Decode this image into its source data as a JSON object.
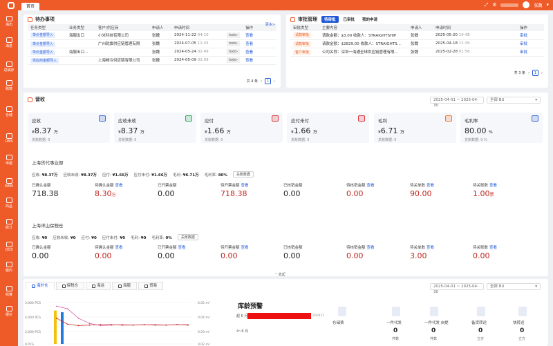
{
  "topbar": {
    "tab": "首页",
    "user": "张魏"
  },
  "sidebar": [
    {
      "label": "海出",
      "icon": "ship-icon"
    },
    {
      "label": "海进",
      "icon": "anchor-icon"
    },
    {
      "label": "进销存",
      "icon": "inventory-icon"
    },
    {
      "label": "跨境",
      "icon": "globe-icon"
    },
    {
      "label": "仓储",
      "icon": "warehouse-icon"
    },
    {
      "label": "OMS",
      "icon": "oms-icon"
    },
    {
      "label": "申报",
      "icon": "declare-icon"
    },
    {
      "label": "WMS",
      "icon": "wms-icon"
    },
    {
      "label": "商品",
      "icon": "goods-icon"
    },
    {
      "label": "统计",
      "icon": "stats-icon"
    },
    {
      "label": "OOS",
      "icon": "oos-icon"
    },
    {
      "label": "履约",
      "icon": "fulfill-icon"
    },
    {
      "label": "结算",
      "icon": "settle-icon"
    },
    {
      "label": "报价",
      "icon": "quote-icon"
    }
  ],
  "todo": {
    "title": "待办事项",
    "more": "更多>",
    "columns": [
      "任务类型",
      "业务类型",
      "客户/供应商",
      "申请人",
      "申请时间",
      "操作"
    ],
    "rows": [
      {
        "type": "单价金额导入",
        "biz": "海服出口",
        "cust": "小米科技有限公司",
        "applicant": "张魏",
        "date": "2024-11-22",
        "time": "04:10",
        "op": "查看",
        "tag": "todo-"
      },
      {
        "type": "单价金额导入",
        "biz": "",
        "cust": "广州乾旗供应链管理有限",
        "applicant": "张魏",
        "date": "2024-07-05",
        "time": "11:43",
        "op": "查看",
        "tag": "todo-"
      },
      {
        "type": "单价金额导入",
        "biz": "海服出口...",
        "cust": "",
        "applicant": "张魏",
        "date": "2024-05-24",
        "time": "02:49",
        "op": "查看",
        "tag": "todo-"
      },
      {
        "type": "供应商金额导入",
        "biz": "",
        "cust": "上海畅冷供应链有限公司",
        "applicant": "张魏",
        "date": "2024-05-09",
        "time": "02:09",
        "op": "查看",
        "tag": "todo-"
      }
    ],
    "total": "共 4 条",
    "page": "1"
  },
  "approval": {
    "title": "审批管理",
    "tabs": [
      "待审批",
      "已审批",
      "我的申请"
    ],
    "columns": [
      "审批类型",
      "主要内容",
      "申请人",
      "申请时间",
      "操作"
    ],
    "rows": [
      {
        "type": "请款审批",
        "content": "请款金额：$3.00 收款人：STRAIGHTSHIP",
        "applicant": "张魏",
        "date": "2025-05-20",
        "time": "10:48",
        "op": "审批"
      },
      {
        "type": "请款审批",
        "content": "请款金额：$2829.00 收款人：STRAIGHTS...",
        "applicant": "张魏",
        "date": "2025-04-18",
        "time": "12:39",
        "op": "审批"
      },
      {
        "type": "客户审批",
        "content": "公司名称：深圳一海通全球供应链管理有限...",
        "applicant": "张魏",
        "date": "2025-02-28",
        "time": "01:56",
        "op": "审批"
      }
    ],
    "total": "共 3 条",
    "page": "1"
  },
  "revenue": {
    "title": "营收",
    "date_range": "2025-04-01 ~ 2025-04-30",
    "bu": "全部 BU",
    "cards": [
      {
        "label": "应收",
        "cur": "¥",
        "value": "8.37",
        "unit": "万",
        "sub": "关账数据: 0",
        "color": "#3b6fd9"
      },
      {
        "label": "应收未收",
        "cur": "¥",
        "value": "8.37",
        "unit": "万",
        "sub": "关账数据: 0",
        "color": "#2fae5e"
      },
      {
        "label": "应付",
        "cur": "¥",
        "value": "1.66",
        "unit": "万",
        "sub": "关账数据: 0",
        "color": "#e0393e"
      },
      {
        "label": "应付未付",
        "cur": "¥",
        "value": "1.66",
        "unit": "万",
        "sub": "关账数据: 0",
        "color": "#e0393e"
      },
      {
        "label": "毛利",
        "cur": "¥",
        "value": "6.71",
        "unit": "万",
        "sub": "关账数据: 0",
        "color": "#ef7a29"
      },
      {
        "label": "毛利率",
        "cur": "",
        "value": "80.00",
        "unit": "%",
        "sub": "关账数据: 0 %",
        "color": "#3b6fd9"
      }
    ]
  },
  "dept1": {
    "name": "上海货代事业部",
    "summary": [
      {
        "k": "应收:",
        "v": "¥8.37万"
      },
      {
        "k": "应收未收:",
        "v": "¥8.37万"
      },
      {
        "k": "应付:",
        "v": "¥1.66万"
      },
      {
        "k": "应付未付:",
        "v": "¥1.66万"
      },
      {
        "k": "毛利:",
        "v": "¥6.71万"
      },
      {
        "k": "毛利率:",
        "v": "80%"
      }
    ],
    "chip": "关账数据",
    "metrics": [
      {
        "label": "已确认金额",
        "link": "",
        "value": "718.38",
        "unit": "",
        "red": false
      },
      {
        "label": "待确认金额",
        "link": "查看",
        "value": "8.30",
        "unit": "万",
        "red": true
      },
      {
        "label": "已开票金额",
        "link": "",
        "value": "0.00",
        "unit": "",
        "red": false
      },
      {
        "label": "待开票金额",
        "link": "查看",
        "value": "718.38",
        "unit": "",
        "red": true
      },
      {
        "label": "已核销金额",
        "link": "",
        "value": "0.00",
        "unit": "",
        "red": false
      },
      {
        "label": "待核销金额",
        "link": "查看",
        "value": "0.00",
        "unit": "",
        "red": true
      },
      {
        "label": "待关单数",
        "link": "查看",
        "value": "90.00",
        "unit": "",
        "red": true
      },
      {
        "label": "待关账数",
        "link": "查看",
        "value": "1.00",
        "unit": "票",
        "red": true
      }
    ]
  },
  "dept2": {
    "name": "上海洋山保税仓",
    "summary": [
      {
        "k": "应收:",
        "v": "¥0"
      },
      {
        "k": "应收未收:",
        "v": "¥0"
      },
      {
        "k": "应付:",
        "v": "¥0"
      },
      {
        "k": "应付未付:",
        "v": "¥0"
      },
      {
        "k": "毛利:",
        "v": "¥0"
      },
      {
        "k": "毛利率:",
        "v": "0%"
      }
    ],
    "chip": "关账数据",
    "metrics": [
      {
        "label": "已确认金额",
        "link": "",
        "value": "0.00",
        "unit": "",
        "red": false
      },
      {
        "label": "待确认金额",
        "link": "查看",
        "value": "0.00",
        "unit": "",
        "red": true
      },
      {
        "label": "已开票金额",
        "link": "查看",
        "value": "0.00",
        "unit": "",
        "red": false
      },
      {
        "label": "待开票金额",
        "link": "查看",
        "value": "0.00",
        "unit": "",
        "red": true
      },
      {
        "label": "已核销金额",
        "link": "",
        "value": "0.00",
        "unit": "",
        "red": false
      },
      {
        "label": "待核销金额",
        "link": "查看",
        "value": "0.00",
        "unit": "",
        "red": true
      },
      {
        "label": "待关单数",
        "link": "查看",
        "value": "3.00",
        "unit": "",
        "red": true
      },
      {
        "label": "待关账数",
        "link": "查看",
        "value": "0.00",
        "unit": "",
        "red": true
      }
    ]
  },
  "collapse_label": "收起",
  "bottom": {
    "tabs": [
      "海外仓",
      "保税仓",
      "海运",
      "海服",
      "贸易"
    ],
    "date_range": "2025-04-01 ~ 2025-04-30",
    "bu": "全部 BU",
    "age_title": "库龄预警",
    "age_rows": [
      {
        "label": "超 6 月",
        "value": "260811"
      },
      {
        "label": "4~6 月",
        "value": ""
      }
    ],
    "warehouse": [
      {
        "title": "仓储费",
        "value": "",
        "unit": ""
      },
      {
        "title": "一件代发",
        "value": "0",
        "unit": "件数"
      },
      {
        "title": "一件代发·自提",
        "value": "0",
        "unit": "件数"
      },
      {
        "title": "备货转运",
        "value": "0",
        "unit": "立方"
      },
      {
        "title": "快转运",
        "value": "0",
        "unit": "立方"
      }
    ]
  },
  "chart_data": {
    "type": "line",
    "y_left_ticks": [
      "3,000 PCS",
      "4,000 PCS",
      "2,000 PCS",
      "0 PCS"
    ],
    "y_right_ticks": [
      "0.05 m³",
      "0.04 m³",
      "0.03 m³",
      "0.02 m³"
    ],
    "bars": [
      {
        "x": 0,
        "value": 3900,
        "color": "#f4c20d"
      },
      {
        "x": 1,
        "value": 3700,
        "color": "#1f7be0"
      }
    ],
    "series": [
      {
        "color": "#e05fa8",
        "values": [
          4400,
          4100,
          3000,
          2400,
          2150,
          2200,
          2250,
          2200,
          2250,
          2250,
          2200,
          2250,
          2250
        ]
      },
      {
        "color": "#c0261e",
        "values": [
          3000,
          2300,
          2150,
          2200,
          2250,
          2250,
          2200,
          2200,
          2250,
          2200,
          2200,
          2250,
          2200
        ]
      }
    ],
    "ylim": [
      0,
      5000
    ]
  }
}
